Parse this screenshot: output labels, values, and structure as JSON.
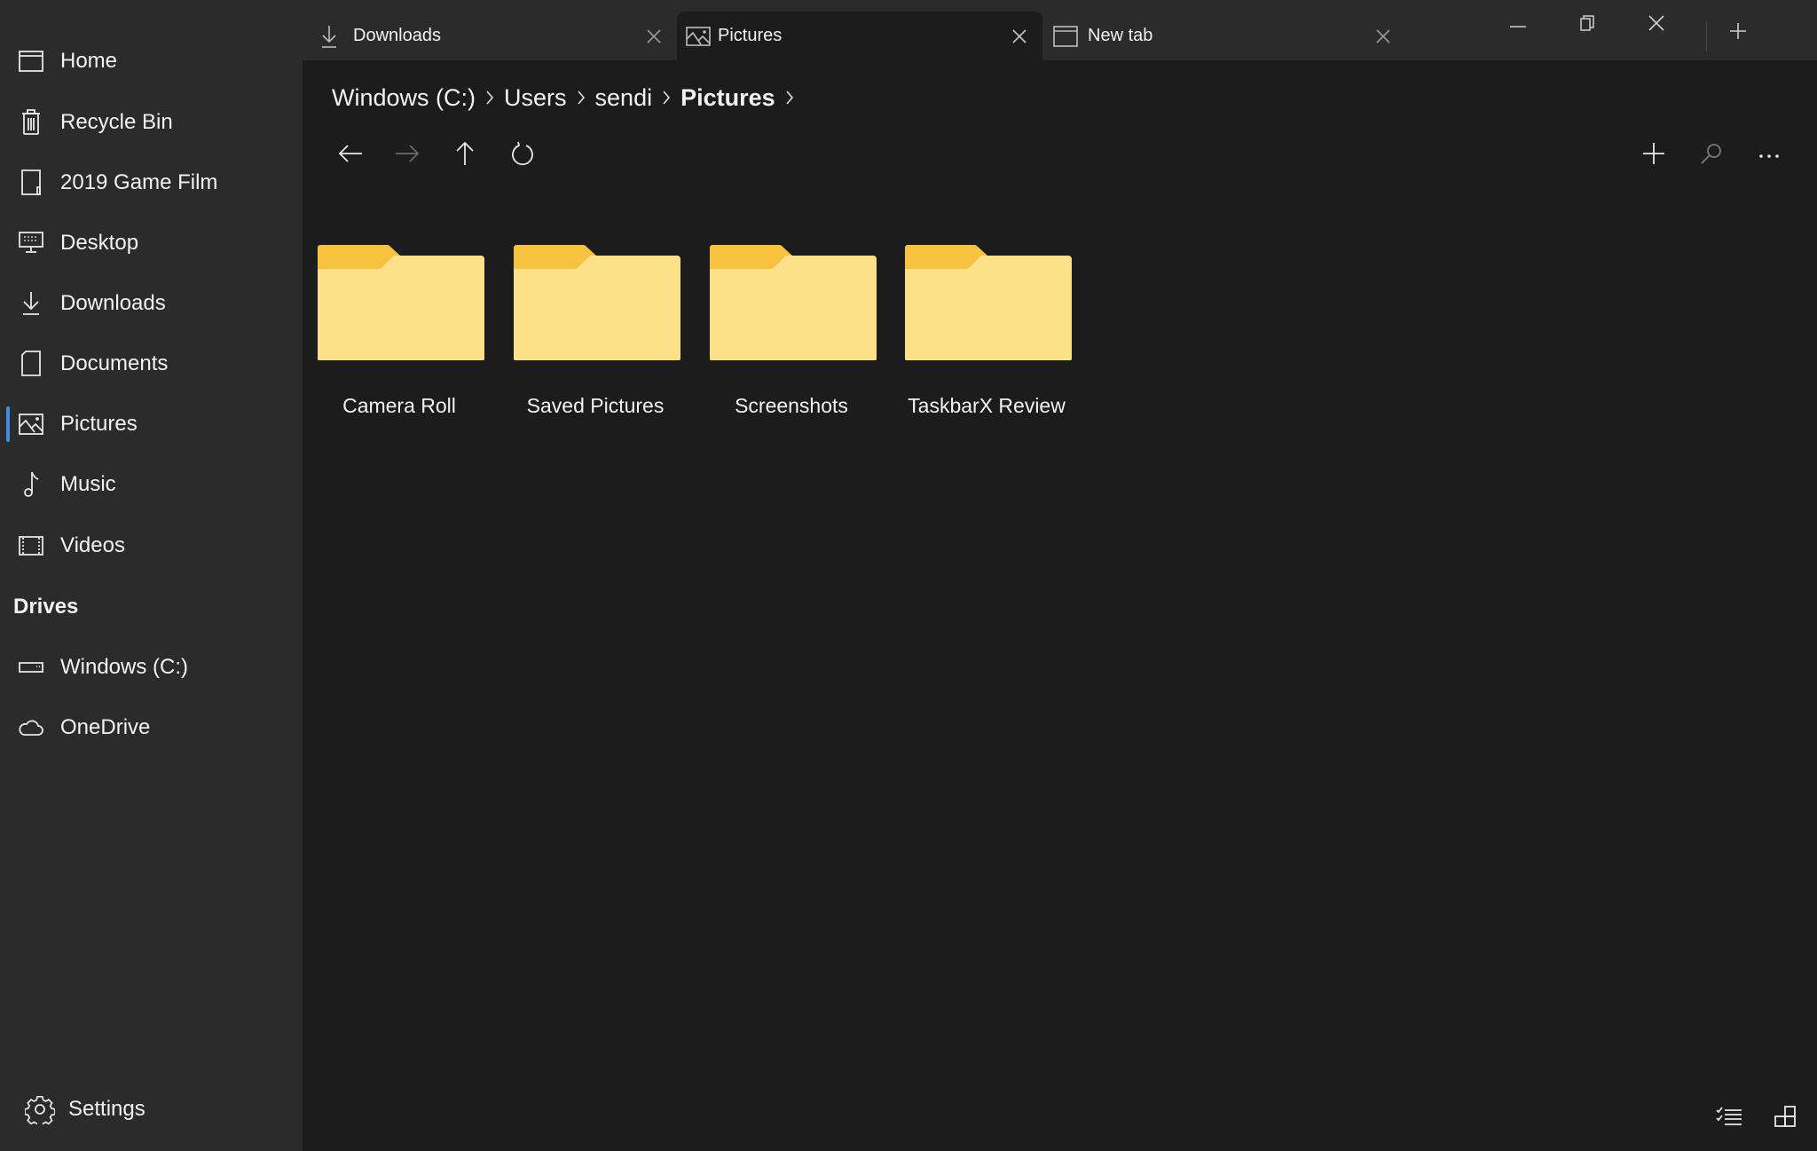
{
  "window": {
    "minimize_icon": "minimize-icon",
    "restore_icon": "restore-icon",
    "close_icon": "close-icon"
  },
  "tabs": [
    {
      "label": "Downloads",
      "icon": "download-icon",
      "active": false
    },
    {
      "label": "Pictures",
      "icon": "picture-icon",
      "active": true
    },
    {
      "label": "New tab",
      "icon": "window-icon",
      "active": false
    }
  ],
  "sidebar": {
    "items": [
      {
        "label": "Home",
        "icon": "home-icon"
      },
      {
        "label": "Recycle Bin",
        "icon": "recycle-bin-icon"
      },
      {
        "label": "2019 Game Film",
        "icon": "folder-pin-icon"
      },
      {
        "label": "Desktop",
        "icon": "desktop-icon"
      },
      {
        "label": "Downloads",
        "icon": "download-icon"
      },
      {
        "label": "Documents",
        "icon": "document-icon"
      },
      {
        "label": "Pictures",
        "icon": "picture-icon",
        "selected": true
      },
      {
        "label": "Music",
        "icon": "music-note-icon"
      },
      {
        "label": "Videos",
        "icon": "video-icon"
      }
    ],
    "drives_header": "Drives",
    "drives": [
      {
        "label": "Windows (C:)",
        "icon": "drive-icon"
      },
      {
        "label": "OneDrive",
        "icon": "cloud-icon"
      }
    ],
    "settings_label": "Settings",
    "accent_color": "#3a8ee6"
  },
  "breadcrumb": [
    {
      "label": "Windows (C:)"
    },
    {
      "label": "Users"
    },
    {
      "label": "sendi"
    },
    {
      "label": "Pictures",
      "current": true
    }
  ],
  "toolbar": {
    "back": "back-arrow-icon",
    "forward": "forward-arrow-icon",
    "up": "up-arrow-icon",
    "refresh": "refresh-icon",
    "new": "add-icon",
    "search": "search-icon",
    "more": "more-icon"
  },
  "folders": [
    {
      "name": "Camera Roll"
    },
    {
      "name": "Saved Pictures"
    },
    {
      "name": "Screenshots"
    },
    {
      "name": "TaskbarX Review"
    }
  ],
  "status_bar": {
    "selection_icon": "multi-select-icon",
    "layout_icon": "layout-mode-icon"
  },
  "colors": {
    "folder_tab": "#f7c33f",
    "folder_body": "#fde28a",
    "accent": "#1a73d9"
  }
}
